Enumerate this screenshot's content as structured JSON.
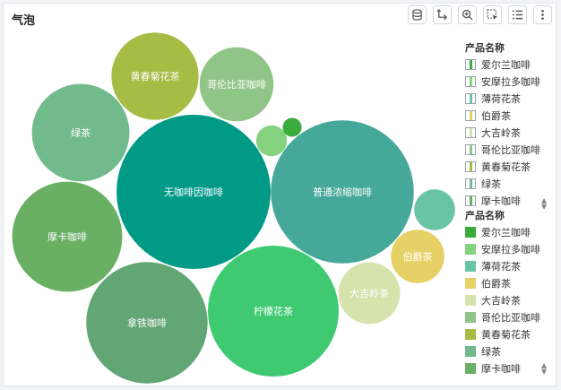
{
  "title": "气泡",
  "toolbar": [
    {
      "name": "database-icon"
    },
    {
      "name": "drill-icon"
    },
    {
      "name": "zoom-in-icon"
    },
    {
      "name": "select-icon"
    },
    {
      "name": "list-icon"
    },
    {
      "name": "more-icon"
    }
  ],
  "chart_data": {
    "type": "bubble",
    "legend_title": "产品名称",
    "legend_placement": "right",
    "series": [
      {
        "label": "无咖啡因咖啡",
        "value": 100,
        "color": "#009a87"
      },
      {
        "label": "普通浓缩咖啡",
        "value": 86,
        "color": "#45a899"
      },
      {
        "label": "柠檬花茶",
        "value": 72,
        "color": "#3fca72"
      },
      {
        "label": "拿铁咖啡",
        "value": 62,
        "color": "#62a676"
      },
      {
        "label": "摩卡咖啡",
        "value": 51,
        "color": "#6ab064"
      },
      {
        "label": "绿茶",
        "value": 40,
        "color": "#71ba8b"
      },
      {
        "label": "黄春菊花茶",
        "value": 32,
        "color": "#a6bc45"
      },
      {
        "label": "哥伦比亚咖啡",
        "value": 23,
        "color": "#8fc586"
      },
      {
        "label": "大吉岭茶",
        "value": 16,
        "color": "#d6e3ad"
      },
      {
        "label": "伯爵茶",
        "value": 12,
        "color": "#e6d166"
      },
      {
        "label": "薄荷花茶",
        "value": 7,
        "color": "#68c4a4"
      },
      {
        "label": "安摩拉多咖啡",
        "value": 4,
        "color": "#85d27e"
      },
      {
        "label": "爱尔兰咖啡",
        "value": 1.5,
        "color": "#3aab3c"
      }
    ],
    "legend_items": [
      "爱尔兰咖啡",
      "安摩拉多咖啡",
      "薄荷花茶",
      "伯爵茶",
      "大吉岭茶",
      "哥伦比亚咖啡",
      "黄春菊花茶",
      "绿茶",
      "摩卡咖啡"
    ]
  }
}
